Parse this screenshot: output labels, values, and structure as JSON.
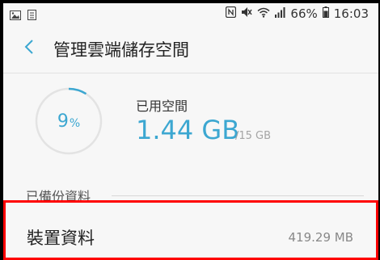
{
  "status_bar": {
    "battery": "66%",
    "time": "16:03"
  },
  "header": {
    "title": "管理雲端儲存空間"
  },
  "storage": {
    "percent": "9",
    "percent_sign": "%",
    "used_fraction": 0.09,
    "used_label": "已用空間",
    "used_value": "1.44 GB",
    "total": "/15 GB"
  },
  "section": {
    "title": "已備份資料"
  },
  "device_data": {
    "label": "裝置資料",
    "size": "419.29 MB"
  },
  "colors": {
    "accent": "#3ca7d1",
    "highlight_border": "#ff0000",
    "background": "#f7f7f7"
  }
}
